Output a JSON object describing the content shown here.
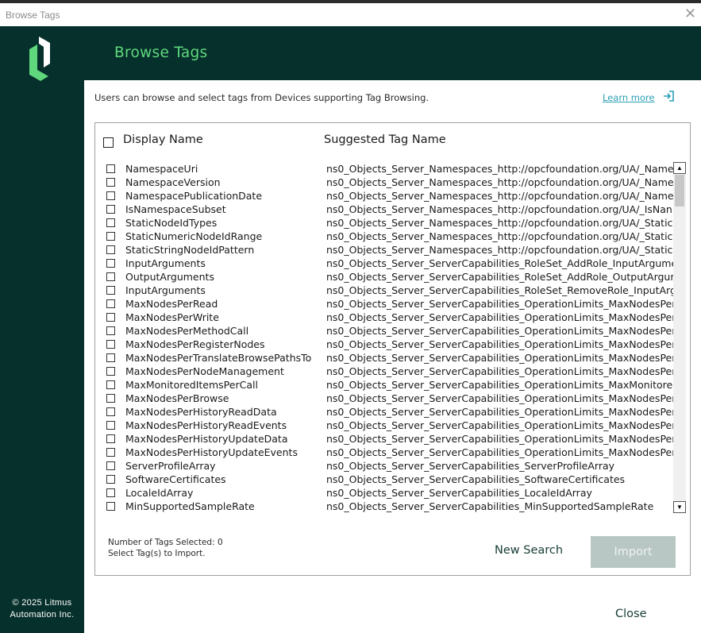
{
  "window": {
    "title": "Browse Tags"
  },
  "sidebar": {
    "copyright_line1": "© 2025 Litmus",
    "copyright_line2": "Automation Inc."
  },
  "header": {
    "title": "Browse Tags"
  },
  "description": "Users can browse and select tags from Devices supporting Tag Browsing.",
  "learn_more": "Learn more",
  "table": {
    "col_display": "Display Name",
    "col_suggested": "Suggested Tag Name",
    "rows": [
      {
        "name": "NamespaceUri",
        "tag": "ns0_Objects_Server_Namespaces_http://opcfoundation.org/UA/_Name"
      },
      {
        "name": "NamespaceVersion",
        "tag": "ns0_Objects_Server_Namespaces_http://opcfoundation.org/UA/_Name"
      },
      {
        "name": "NamespacePublicationDate",
        "tag": "ns0_Objects_Server_Namespaces_http://opcfoundation.org/UA/_Name"
      },
      {
        "name": "IsNamespaceSubset",
        "tag": "ns0_Objects_Server_Namespaces_http://opcfoundation.org/UA/_IsNan"
      },
      {
        "name": "StaticNodeIdTypes",
        "tag": "ns0_Objects_Server_Namespaces_http://opcfoundation.org/UA/_Static"
      },
      {
        "name": "StaticNumericNodeIdRange",
        "tag": "ns0_Objects_Server_Namespaces_http://opcfoundation.org/UA/_Static"
      },
      {
        "name": "StaticStringNodeIdPattern",
        "tag": "ns0_Objects_Server_Namespaces_http://opcfoundation.org/UA/_Static"
      },
      {
        "name": "InputArguments",
        "tag": "ns0_Objects_Server_ServerCapabilities_RoleSet_AddRole_InputArgume"
      },
      {
        "name": "OutputArguments",
        "tag": "ns0_Objects_Server_ServerCapabilities_RoleSet_AddRole_OutputArgum"
      },
      {
        "name": "InputArguments",
        "tag": "ns0_Objects_Server_ServerCapabilities_RoleSet_RemoveRole_InputArg"
      },
      {
        "name": "MaxNodesPerRead",
        "tag": "ns0_Objects_Server_ServerCapabilities_OperationLimits_MaxNodesPer"
      },
      {
        "name": "MaxNodesPerWrite",
        "tag": "ns0_Objects_Server_ServerCapabilities_OperationLimits_MaxNodesPer"
      },
      {
        "name": "MaxNodesPerMethodCall",
        "tag": "ns0_Objects_Server_ServerCapabilities_OperationLimits_MaxNodesPer"
      },
      {
        "name": "MaxNodesPerRegisterNodes",
        "tag": "ns0_Objects_Server_ServerCapabilities_OperationLimits_MaxNodesPer"
      },
      {
        "name": "MaxNodesPerTranslateBrowsePathsTo",
        "tag": "ns0_Objects_Server_ServerCapabilities_OperationLimits_MaxNodesPer"
      },
      {
        "name": "MaxNodesPerNodeManagement",
        "tag": "ns0_Objects_Server_ServerCapabilities_OperationLimits_MaxNodesPer"
      },
      {
        "name": "MaxMonitoredItemsPerCall",
        "tag": "ns0_Objects_Server_ServerCapabilities_OperationLimits_MaxMonitored"
      },
      {
        "name": "MaxNodesPerBrowse",
        "tag": "ns0_Objects_Server_ServerCapabilities_OperationLimits_MaxNodesPer"
      },
      {
        "name": "MaxNodesPerHistoryReadData",
        "tag": "ns0_Objects_Server_ServerCapabilities_OperationLimits_MaxNodesPer"
      },
      {
        "name": "MaxNodesPerHistoryReadEvents",
        "tag": "ns0_Objects_Server_ServerCapabilities_OperationLimits_MaxNodesPer"
      },
      {
        "name": "MaxNodesPerHistoryUpdateData",
        "tag": "ns0_Objects_Server_ServerCapabilities_OperationLimits_MaxNodesPer"
      },
      {
        "name": "MaxNodesPerHistoryUpdateEvents",
        "tag": "ns0_Objects_Server_ServerCapabilities_OperationLimits_MaxNodesPer"
      },
      {
        "name": "ServerProfileArray",
        "tag": "ns0_Objects_Server_ServerCapabilities_ServerProfileArray"
      },
      {
        "name": "SoftwareCertificates",
        "tag": "ns0_Objects_Server_ServerCapabilities_SoftwareCertificates"
      },
      {
        "name": "LocaleIdArray",
        "tag": "ns0_Objects_Server_ServerCapabilities_LocaleIdArray"
      },
      {
        "name": "MinSupportedSampleRate",
        "tag": "ns0_Objects_Server_ServerCapabilities_MinSupportedSampleRate"
      }
    ]
  },
  "footer": {
    "count_label": "Number of Tags Selected: 0",
    "hint": "Select Tag(s) to Import.",
    "new_search": "New Search",
    "import": "Import"
  },
  "close": "Close",
  "colors": {
    "dark": "#06302b",
    "accent": "#5fd87d",
    "link": "#2a9fb5"
  }
}
